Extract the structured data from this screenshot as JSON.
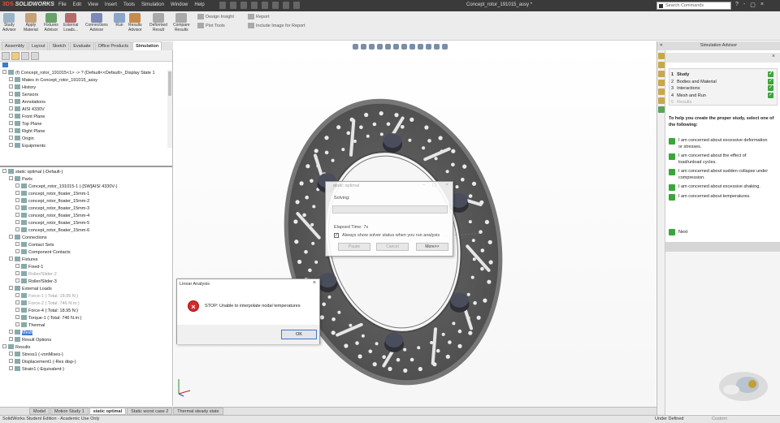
{
  "app": {
    "brand": "SOLIDWORKS",
    "menus": [
      "File",
      "Edit",
      "View",
      "Insert",
      "Tools",
      "Simulation",
      "Window",
      "Help"
    ],
    "doc_title": "Concept_rotor_191015_assy *",
    "search_placeholder": "Search Commands",
    "window_controls": [
      "?",
      "-",
      "▢",
      "×"
    ]
  },
  "ribbon": {
    "buttons": [
      {
        "label1": "Study",
        "label2": "Advisor"
      },
      {
        "label1": "Apply",
        "label2": "Material"
      },
      {
        "label1": "Fixtures",
        "label2": "Advisor"
      },
      {
        "label1": "External",
        "label2": "Loads..."
      },
      {
        "label1": "Connections",
        "label2": "Advisor"
      },
      {
        "label1": "Run",
        "label2": ""
      },
      {
        "label1": "Results",
        "label2": "Advisor"
      },
      {
        "label1": "Deformed",
        "label2": "Result"
      },
      {
        "label1": "Compare",
        "label2": "Results"
      }
    ],
    "design_insight": "Design Insight",
    "plot_tools": "Plot Tools",
    "report": "Report",
    "include_image": "Include Image for Report"
  },
  "command_tabs": [
    "Assembly",
    "Layout",
    "Sketch",
    "Evaluate",
    "Office Products",
    "Simulation"
  ],
  "feature_tree": [
    {
      "text": "(f) Concept_rotor_191015<1> -> ? (Default<<Default>_Display State 1",
      "indent": 0
    },
    {
      "text": "Mates in Concept_rotor_191015_assy",
      "indent": 1
    },
    {
      "text": "History",
      "indent": 1
    },
    {
      "text": "Sensors",
      "indent": 1
    },
    {
      "text": "Annotations",
      "indent": 1
    },
    {
      "text": "AISI 4330V",
      "indent": 1
    },
    {
      "text": "Front Plane",
      "indent": 1
    },
    {
      "text": "Top Plane",
      "indent": 1
    },
    {
      "text": "Right Plane",
      "indent": 1
    },
    {
      "text": "Origin",
      "indent": 1
    },
    {
      "text": "Equipments",
      "indent": 1
    }
  ],
  "study_tree": [
    {
      "text": "static optimal (-Default-)",
      "indent": 0,
      "state": "normal"
    },
    {
      "text": "Parts",
      "indent": 1,
      "state": "normal"
    },
    {
      "text": "Concept_rotor_191015-1 (-[SW]AISI 4330V-)",
      "indent": 2,
      "state": "normal"
    },
    {
      "text": "concept_rotor_floater_15mm-1",
      "indent": 2,
      "state": "normal"
    },
    {
      "text": "concept_rotor_floater_15mm-2",
      "indent": 2,
      "state": "normal"
    },
    {
      "text": "concept_rotor_floater_15mm-3",
      "indent": 2,
      "state": "normal"
    },
    {
      "text": "concept_rotor_floater_15mm-4",
      "indent": 2,
      "state": "normal"
    },
    {
      "text": "concept_rotor_floater_15mm-5",
      "indent": 2,
      "state": "normal"
    },
    {
      "text": "concept_rotor_floater_15mm-6",
      "indent": 2,
      "state": "normal"
    },
    {
      "text": "Connections",
      "indent": 1,
      "state": "normal"
    },
    {
      "text": "Contact Sets",
      "indent": 2,
      "state": "normal"
    },
    {
      "text": "Component Contacts",
      "indent": 2,
      "state": "normal"
    },
    {
      "text": "Fixtures",
      "indent": 1,
      "state": "normal"
    },
    {
      "text": "Fixed-1",
      "indent": 2,
      "state": "normal"
    },
    {
      "text": "Roller/Slider-2",
      "indent": 2,
      "state": "dim"
    },
    {
      "text": "Roller/Slider-3",
      "indent": 2,
      "state": "normal"
    },
    {
      "text": "External Loads",
      "indent": 1,
      "state": "normal"
    },
    {
      "text": "Force-1 (:Total: 18.95 N:)",
      "indent": 2,
      "state": "dim"
    },
    {
      "text": "Force-2 (:Total: 746 N:m:)",
      "indent": 2,
      "state": "dim"
    },
    {
      "text": "Force-4 (:Total: 18.95 N:)",
      "indent": 2,
      "state": "normal"
    },
    {
      "text": "Torque-1 (:Total: 746 N.m:)",
      "indent": 2,
      "state": "normal"
    },
    {
      "text": "Thermal",
      "indent": 2,
      "state": "normal"
    },
    {
      "text": "Mesh",
      "indent": 1,
      "state": "highlight"
    },
    {
      "text": "Result Options",
      "indent": 1,
      "state": "normal"
    },
    {
      "text": "Results",
      "indent": 0,
      "state": "normal"
    },
    {
      "text": "Stress1 (-vonMises-)",
      "indent": 1,
      "state": "normal"
    },
    {
      "text": "Displacement1 (-Res disp-)",
      "indent": 1,
      "state": "normal"
    },
    {
      "text": "Strain1 (-Equivalent-)",
      "indent": 1,
      "state": "normal"
    }
  ],
  "bottom_tabs": [
    "Model",
    "Motion Study 1",
    "static optimal",
    "Static worst case 2",
    "Thermal steady state"
  ],
  "status": {
    "left": "SolidWorks Student Edition - Academic Use Only",
    "mid": "Under Defined",
    "custom": "Custom"
  },
  "solver_dialog": {
    "title": "static optimal",
    "solving_label": "Solving:",
    "elapsed": "Elapsed Time: 7s",
    "checkbox_label": "Always show solver status when you run analysis",
    "pause": "Pause",
    "cancel": "Cancel",
    "more": "More>>"
  },
  "error_dialog": {
    "title": "Linear Analysis",
    "message": "STOP: Unable to interpolate nodal temperatures",
    "ok": "OK"
  },
  "advisor": {
    "title": "Simulation Advisor",
    "steps": [
      {
        "num": "1",
        "label": "Study",
        "done": true
      },
      {
        "num": "2",
        "label": "Bodies and Material",
        "done": true
      },
      {
        "num": "3",
        "label": "Interactions",
        "done": true
      },
      {
        "num": "4",
        "label": "Mesh and Run",
        "done": true
      },
      {
        "num": "5",
        "label": "Results",
        "done": false
      }
    ],
    "intro": "To help you create the proper study, select one of the following:",
    "options": [
      {
        "l1": "I am concerned about excessive deformation",
        "l2": "or stresses."
      },
      {
        "l1": "I am concerned about the effect of",
        "l2": "load/unload cycles."
      },
      {
        "l1": "I am concerned about sudden collapse under",
        "l2": "compression."
      },
      {
        "l1": "I am concerned about excessive shaking.",
        "l2": ""
      },
      {
        "l1": "I am concerned about temperatures.",
        "l2": ""
      }
    ],
    "next": "Next"
  },
  "colors": {
    "titlebar": "#3a3a3a",
    "rotor": "#5d5d5d",
    "check_green": "#3aa63a",
    "error_red": "#d12b2b",
    "selection_blue": "#3a7bd5"
  }
}
